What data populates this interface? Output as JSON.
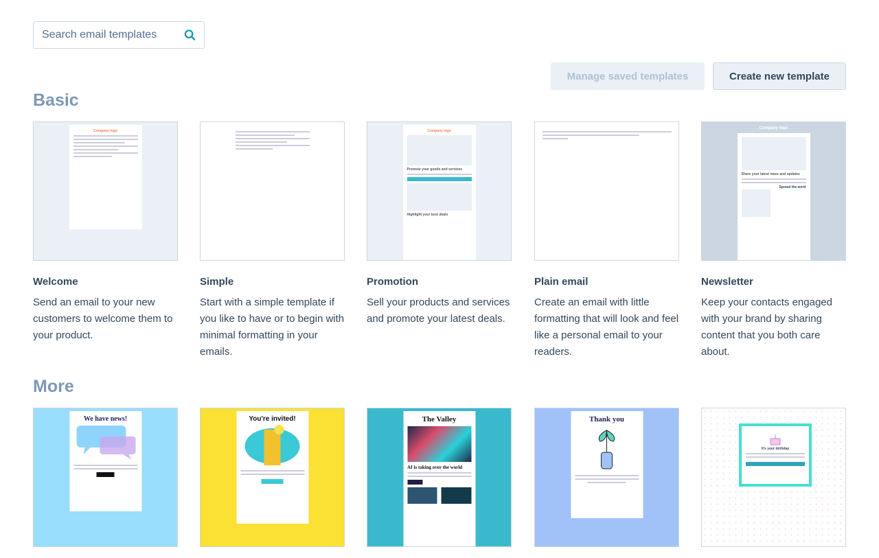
{
  "search": {
    "placeholder": "Search email templates",
    "icon": "search-icon"
  },
  "toolbar": {
    "manage_label": "Manage saved templates",
    "create_label": "Create new template"
  },
  "sections": [
    {
      "title": "Basic",
      "cards": [
        {
          "title": "Welcome",
          "desc": "Send an email to your new customers to welcome them to your product.",
          "thumb": "Company logo"
        },
        {
          "title": "Simple",
          "desc": "Start with a simple template if you like to have or to begin with minimal formatting in your emails."
        },
        {
          "title": "Promotion",
          "desc": "Sell your products and services and promote your latest deals.",
          "thumb": "Company logo",
          "heading": "Promote your goods and services",
          "sub": "Highlight your best deals"
        },
        {
          "title": "Plain email",
          "desc": "Create an email with little formatting that will look and feel like a personal email to your readers."
        },
        {
          "title": "Newsletter",
          "desc": "Keep your contacts engaged with your brand by sharing content that you both care about.",
          "thumb": "Company logo",
          "heading": "Share your latest news and updates",
          "sub": "Spread the word"
        }
      ]
    },
    {
      "title": "More",
      "cards": [
        {
          "heading": "We have news!",
          "bg": "#99ddfc"
        },
        {
          "heading": "You're invited!",
          "bg": "#fbe134"
        },
        {
          "heading": "The Valley",
          "sub": "AI is taking over the world",
          "bg": "#3bb9cc"
        },
        {
          "heading": "Thank you",
          "bg": "#a1c2f9"
        },
        {
          "heading": "It's your birthday",
          "bg": "#ffffff"
        }
      ]
    }
  ]
}
